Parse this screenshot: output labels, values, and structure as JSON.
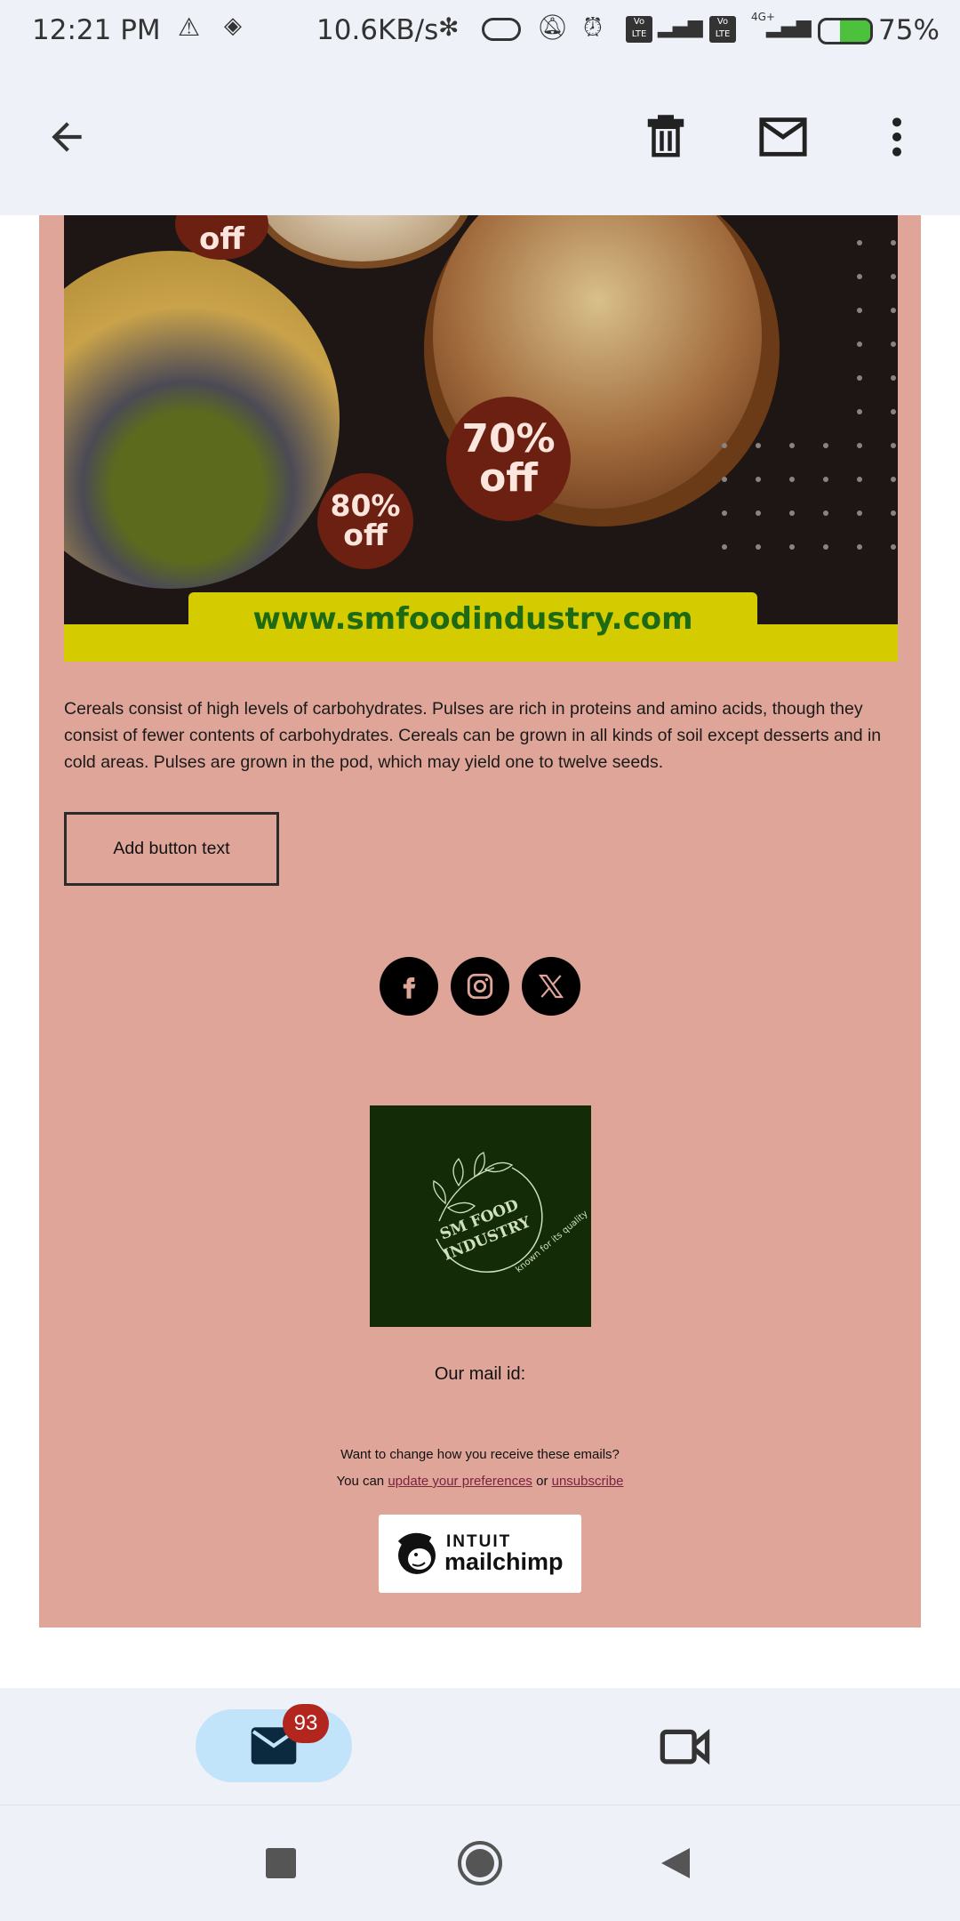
{
  "status_bar": {
    "time": "12:21 PM",
    "net_speed": "10.6KB/s",
    "battery": "75%",
    "network": "4G+",
    "volte_1": "Vo LTE",
    "volte_2": "Vo LTE",
    "battery_level": 75
  },
  "app_bar": {
    "icons": [
      "back-arrow-icon",
      "trash-icon",
      "mail-icon",
      "more-vert-icon"
    ]
  },
  "banner": {
    "badge_top": "off",
    "badge_left_pct": "80%",
    "badge_left_off": "off",
    "badge_right_pct": "70%",
    "badge_right_off": "off",
    "website": "www.smfoodindustry.com"
  },
  "email": {
    "paragraph": "Cereals consist of high levels of carbohydrates. Pulses are rich in proteins and amino acids, though they consist of fewer contents of carbohydrates. Cereals can be grown in all kinds of soil except desserts and in cold areas. Pulses are grown in the pod, which may yield one to twelve seeds.",
    "button_label": "Add button text",
    "social": [
      "facebook-icon",
      "instagram-icon",
      "x-icon"
    ],
    "logo": {
      "line1": "SM FOOD",
      "line2": "INDUSTRY",
      "tagline": "known for its quality"
    },
    "mail_id_label": "Our mail id:",
    "footer_q": "Want to change how you receive these emails?",
    "footer_you_can": "You can",
    "footer_update": "update your preferences",
    "footer_or": "or",
    "footer_unsub": "unsubscribe",
    "mailchimp_top": "INTUIT",
    "mailchimp_bottom": "mailchimp"
  },
  "bottom_nav": {
    "mail_badge": "93",
    "items": [
      "mail-icon",
      "video-icon"
    ]
  },
  "colors": {
    "card": "#dfa599",
    "banner_yellow": "#d4cc00",
    "logo_bg": "#132b07",
    "badge": "#b3261e",
    "pill": "#c2e4fb"
  }
}
